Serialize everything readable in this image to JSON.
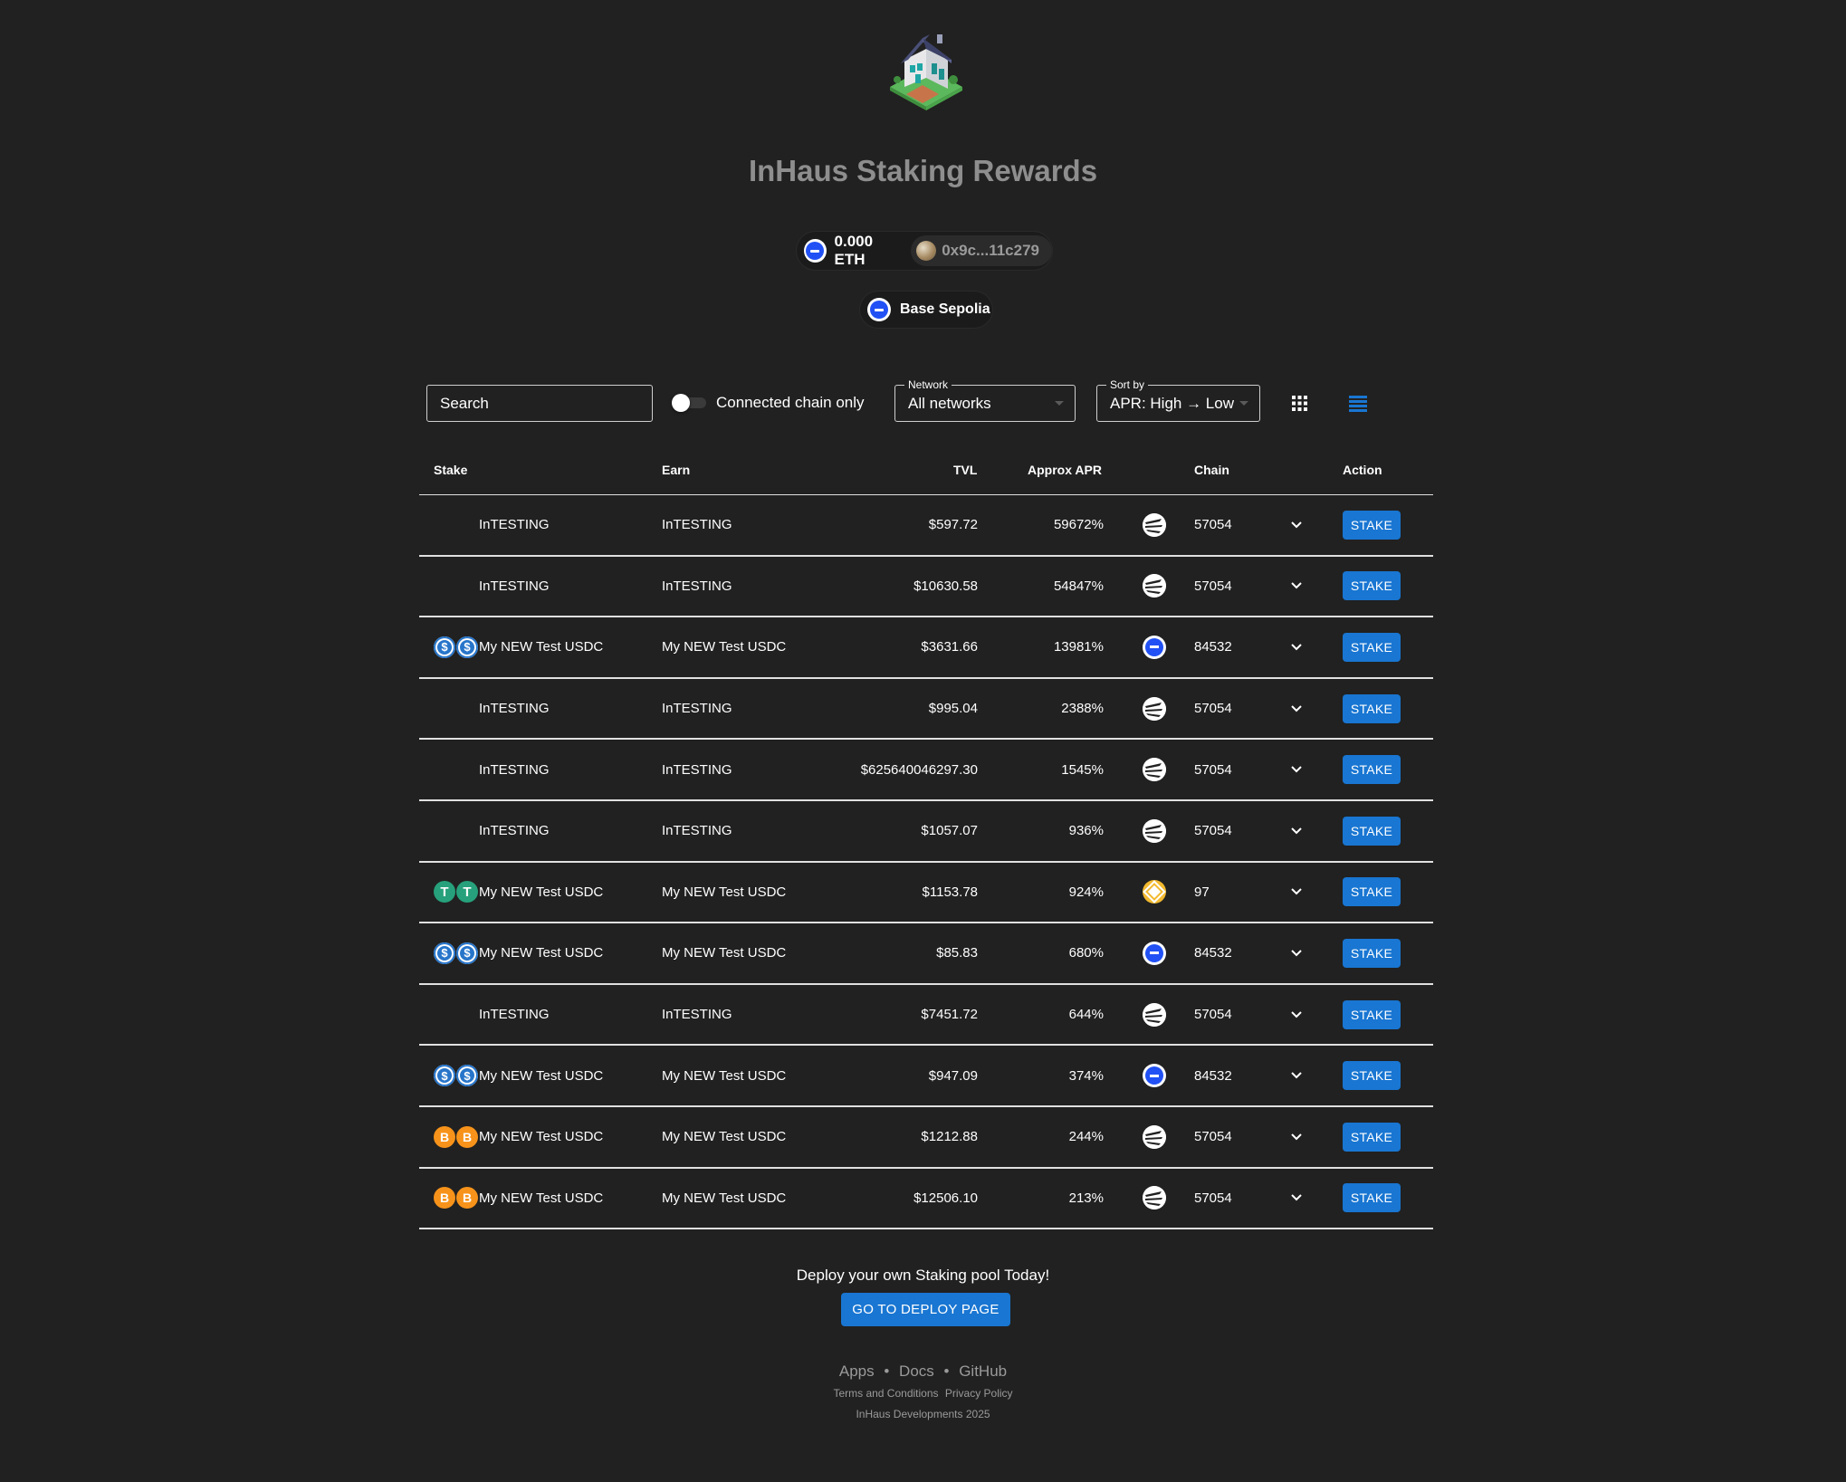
{
  "header": {
    "title": "InHaus Staking Rewards",
    "wallet_balance": "0.000 ETH",
    "wallet_address": "0x9c...11c279",
    "network_name": "Base Sepolia"
  },
  "controls": {
    "search_placeholder": "Search",
    "toggle_label": "Connected chain only",
    "toggle_on": false,
    "network_label": "Network",
    "network_value": "All networks",
    "sort_label": "Sort by",
    "sort_value": "APR: High → Low",
    "view_grid_icon": "grid-view-icon",
    "view_list_icon": "list-view-icon"
  },
  "table": {
    "columns": {
      "stake": "Stake",
      "earn": "Earn",
      "tvl": "TVL",
      "apr": "Approx APR",
      "chain": "Chain",
      "action": "Action"
    },
    "action_label": "STAKE",
    "rows": [
      {
        "token": "intesting",
        "stake": "InTESTING",
        "earn": "InTESTING",
        "tvl": "$597.72",
        "apr": "59672%",
        "chain_icon": "whitefan",
        "chain": "57054"
      },
      {
        "token": "intesting",
        "stake": "InTESTING",
        "earn": "InTESTING",
        "tvl": "$10630.58",
        "apr": "54847%",
        "chain_icon": "whitefan",
        "chain": "57054"
      },
      {
        "token": "usdc",
        "stake": "My NEW Test USDC",
        "earn": "My NEW Test USDC",
        "tvl": "$3631.66",
        "apr": "13981%",
        "chain_icon": "base",
        "chain": "84532"
      },
      {
        "token": "intesting",
        "stake": "InTESTING",
        "earn": "InTESTING",
        "tvl": "$995.04",
        "apr": "2388%",
        "chain_icon": "whitefan",
        "chain": "57054"
      },
      {
        "token": "intesting",
        "stake": "InTESTING",
        "earn": "InTESTING",
        "tvl": "$625640046297.30",
        "apr": "1545%",
        "chain_icon": "whitefan",
        "chain": "57054"
      },
      {
        "token": "intesting",
        "stake": "InTESTING",
        "earn": "InTESTING",
        "tvl": "$1057.07",
        "apr": "936%",
        "chain_icon": "whitefan",
        "chain": "57054"
      },
      {
        "token": "usdt",
        "stake": "My NEW Test USDC",
        "earn": "My NEW Test USDC",
        "tvl": "$1153.78",
        "apr": "924%",
        "chain_icon": "bnb",
        "chain": "97"
      },
      {
        "token": "usdc",
        "stake": "My NEW Test USDC",
        "earn": "My NEW Test USDC",
        "tvl": "$85.83",
        "apr": "680%",
        "chain_icon": "base",
        "chain": "84532"
      },
      {
        "token": "intesting",
        "stake": "InTESTING",
        "earn": "InTESTING",
        "tvl": "$7451.72",
        "apr": "644%",
        "chain_icon": "whitefan",
        "chain": "57054"
      },
      {
        "token": "usdc",
        "stake": "My NEW Test USDC",
        "earn": "My NEW Test USDC",
        "tvl": "$947.09",
        "apr": "374%",
        "chain_icon": "base",
        "chain": "84532"
      },
      {
        "token": "btc",
        "stake": "My NEW Test USDC",
        "earn": "My NEW Test USDC",
        "tvl": "$1212.88",
        "apr": "244%",
        "chain_icon": "whitefan",
        "chain": "57054"
      },
      {
        "token": "btc",
        "stake": "My NEW Test USDC",
        "earn": "My NEW Test USDC",
        "tvl": "$12506.10",
        "apr": "213%",
        "chain_icon": "whitefan",
        "chain": "57054"
      }
    ]
  },
  "footer": {
    "deploy_text": "Deploy your own Staking pool Today!",
    "deploy_button": "GO TO DEPLOY PAGE",
    "links": [
      "Apps",
      "Docs",
      "GitHub"
    ],
    "separator": "•",
    "terms": "Terms and Conditions",
    "privacy": "Privacy Policy",
    "copyright": "InHaus Developments 2025"
  },
  "colors": {
    "background": "#212121",
    "accent": "#1976d2",
    "title": "#8e8e8e"
  }
}
